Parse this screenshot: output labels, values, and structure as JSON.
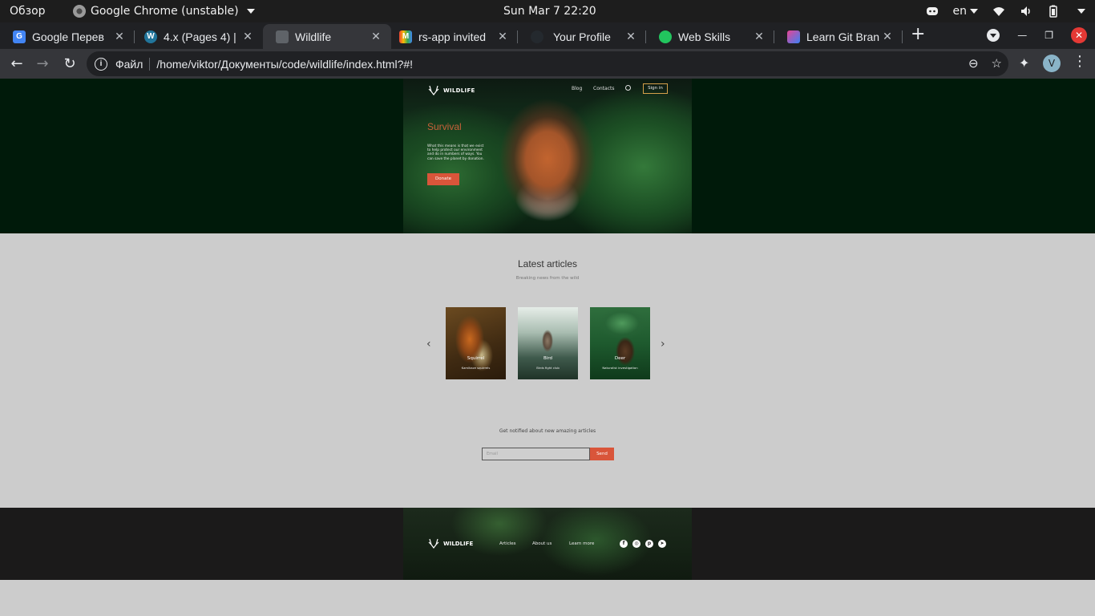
{
  "system_bar": {
    "activities": "Обзор",
    "app_name": "Google Chrome (unstable)",
    "clock": "Sun Mar 7  22:20",
    "keyboard_layout": "en"
  },
  "tabs": [
    {
      "title": "Google Перев",
      "favicon": "google-translate-icon",
      "active": false
    },
    {
      "title": "4.x (Pages 4) |",
      "favicon": "wordpress-icon",
      "active": false
    },
    {
      "title": "Wildlife",
      "favicon": "page-icon",
      "active": true
    },
    {
      "title": "rs-app invited",
      "favicon": "gmail-icon",
      "active": false
    },
    {
      "title": "Your Profile",
      "favicon": "github-icon",
      "active": false
    },
    {
      "title": "Web Skills",
      "favicon": "web-skills-icon",
      "active": false
    },
    {
      "title": "Learn Git Bran",
      "favicon": "learngit-icon",
      "active": false
    }
  ],
  "toolbar": {
    "scheme_label": "Файл",
    "url": "/home/viktor/Документы/code/wildlife/index.html?#!",
    "profile_initial": "V"
  },
  "site": {
    "brand": "WILDLIFE",
    "nav": [
      "Blog",
      "Contacts"
    ],
    "sign_in": "Sign in",
    "hero_title": "Survival",
    "hero_text": "What this means is that we exist to help protect our environment and do in numbers of ways. You can save the planet by donation.",
    "donate": "Donate",
    "articles_title": "Latest articles",
    "articles_subtitle": "Breaking news from the wild",
    "cards": [
      {
        "name": "Squirrel",
        "desc": "Kamikaze squirrels"
      },
      {
        "name": "Bird",
        "desc": "Birds fight club"
      },
      {
        "name": "Deer",
        "desc": "Naturalist investigation"
      }
    ],
    "notify_text": "Get notified about new amazing articles",
    "email_placeholder": "Email",
    "send": "Send",
    "footer_links": [
      "Articles",
      "About us",
      "Learn more"
    ],
    "social": [
      "facebook-icon",
      "instagram-icon",
      "pinterest-icon",
      "telegram-icon"
    ]
  },
  "colors": {
    "accent": "#d9553a",
    "hero_band": "#001a0a",
    "footer_band": "#1b1a1a",
    "page_bg": "#cccccc"
  }
}
